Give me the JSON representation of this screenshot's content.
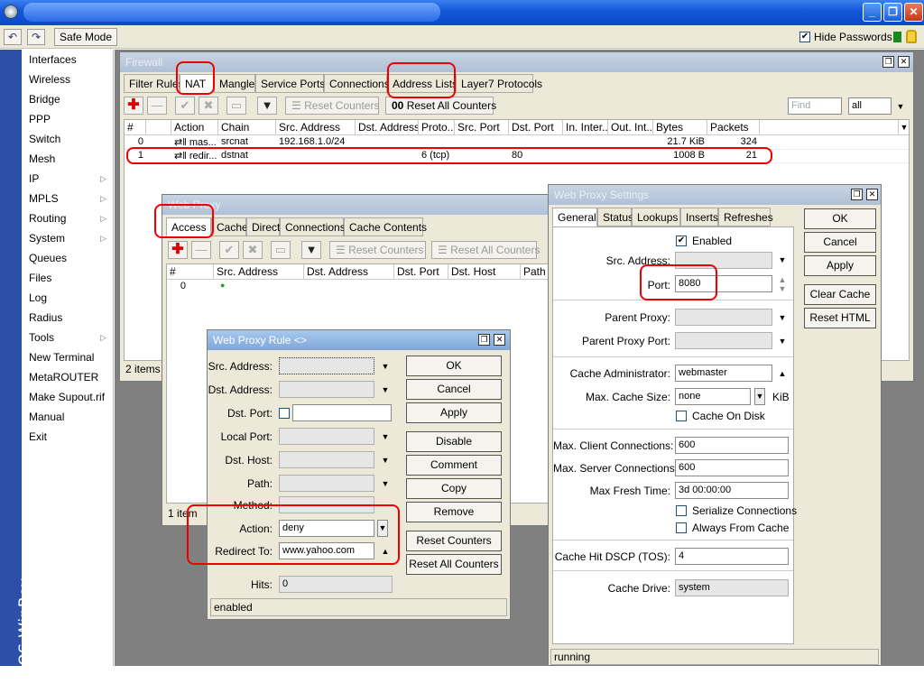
{
  "toolbar": {
    "undo_icon": "undo-icon",
    "redo_icon": "redo-icon",
    "safe_mode": "Safe Mode",
    "hide_passwords": "Hide Passwords",
    "hide_passwords_checked": "✔"
  },
  "brand": "RouterOS WinBox",
  "menu": [
    {
      "label": "Interfaces"
    },
    {
      "label": "Wireless"
    },
    {
      "label": "Bridge"
    },
    {
      "label": "PPP"
    },
    {
      "label": "Switch"
    },
    {
      "label": "Mesh"
    },
    {
      "label": "IP",
      "submenu": true
    },
    {
      "label": "MPLS",
      "submenu": true
    },
    {
      "label": "Routing",
      "submenu": true
    },
    {
      "label": "System",
      "submenu": true
    },
    {
      "label": "Queues"
    },
    {
      "label": "Files"
    },
    {
      "label": "Log"
    },
    {
      "label": "Radius"
    },
    {
      "label": "Tools",
      "submenu": true
    },
    {
      "label": "New Terminal"
    },
    {
      "label": "MetaROUTER"
    },
    {
      "label": "Make Supout.rif"
    },
    {
      "label": "Manual"
    },
    {
      "label": "Exit"
    }
  ],
  "firewall": {
    "title": "Firewall",
    "tabs": [
      "Filter Rules",
      "NAT",
      "Mangle",
      "Service Ports",
      "Connections",
      "Address Lists",
      "Layer7 Protocols"
    ],
    "reset_counters": "Reset Counters",
    "reset_all_counters": "Reset All Counters",
    "reset_all_prefix": "00",
    "find_placeholder": "Find",
    "filter_value": "all",
    "columns": [
      "#",
      "",
      "Action",
      "Chain",
      "Src. Address",
      "Dst. Address",
      "Proto...",
      "Src. Port",
      "Dst. Port",
      "In. Inter...",
      "Out. Int...",
      "Bytes",
      "Packets"
    ],
    "rows": [
      {
        "num": "0",
        "action": "⇄‖ mas...",
        "chain": "srcnat",
        "src": "192.168.1.0/24",
        "dst": "",
        "proto": "",
        "sport": "",
        "dport": "",
        "in": "",
        "out": "",
        "bytes": "21.7 KiB",
        "packets": "324"
      },
      {
        "num": "1",
        "action": "⇄‖ redir...",
        "chain": "dstnat",
        "src": "",
        "dst": "",
        "proto": "6 (tcp)",
        "sport": "",
        "dport": "80",
        "in": "",
        "out": "",
        "bytes": "1008 B",
        "packets": "21"
      }
    ],
    "status": "2 items"
  },
  "webproxy": {
    "title": "Web Proxy",
    "tabs": [
      "Access",
      "Cache",
      "Direct",
      "Connections",
      "Cache Contents"
    ],
    "reset_counters": "Reset Counters",
    "reset_all_counters": "Reset All Counters",
    "columns": [
      "#",
      "Src. Address",
      "Dst. Address",
      "Dst. Port",
      "Dst. Host",
      "Path"
    ],
    "rows": [
      {
        "num": "0",
        "src": "●"
      }
    ],
    "status": "1 item"
  },
  "rule": {
    "title": "Web Proxy Rule <>",
    "labels": {
      "src": "Src. Address:",
      "dst": "Dst. Address:",
      "dport": "Dst. Port:",
      "lport": "Local Port:",
      "dhost": "Dst. Host:",
      "path": "Path:",
      "method": "Method:",
      "action": "Action:",
      "redirect": "Redirect To:",
      "hits": "Hits:"
    },
    "values": {
      "action": "deny",
      "redirect": "www.yahoo.com",
      "hits": "0"
    },
    "buttons": [
      "OK",
      "Cancel",
      "Apply",
      "Disable",
      "Comment",
      "Copy",
      "Remove",
      "Reset Counters",
      "Reset All Counters"
    ],
    "status": "enabled"
  },
  "settings": {
    "title": "Web Proxy Settings",
    "tabs": [
      "General",
      "Status",
      "Lookups",
      "Inserts",
      "Refreshes"
    ],
    "enabled_label": "Enabled",
    "enabled_check": "✔",
    "labels": {
      "src": "Src. Address:",
      "port": "Port:",
      "parent": "Parent Proxy:",
      "parent_port": "Parent Proxy Port:",
      "admin": "Cache Administrator:",
      "max_cache": "Max. Cache Size:",
      "cache_disk": "Cache On Disk",
      "max_client": "Max. Client Connections:",
      "max_server": "Max. Server Connections:",
      "max_fresh": "Max Fresh Time:",
      "serialize": "Serialize Connections",
      "always": "Always From Cache",
      "dscp": "Cache Hit DSCP (TOS):",
      "drive": "Cache Drive:"
    },
    "values": {
      "port": "8080",
      "admin": "webmaster",
      "max_cache": "none",
      "kib": "KiB",
      "max_client": "600",
      "max_server": "600",
      "max_fresh": "3d 00:00:00",
      "dscp": "4",
      "drive": "system"
    },
    "buttons": [
      "OK",
      "Cancel",
      "Apply",
      "Clear Cache",
      "Reset HTML"
    ],
    "status": "running"
  }
}
